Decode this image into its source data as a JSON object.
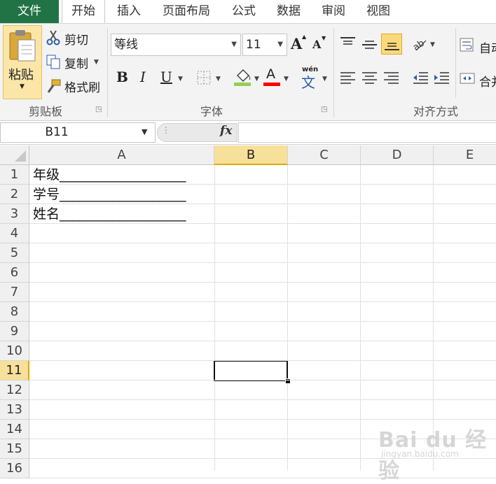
{
  "tabs": {
    "file": "文件",
    "home": "开始",
    "insert": "插入",
    "page_layout": "页面布局",
    "formulas": "公式",
    "data": "数据",
    "review": "审阅",
    "view": "视图"
  },
  "clipboard": {
    "paste": "粘贴",
    "cut": "剪切",
    "copy": "复制",
    "format_painter": "格式刷",
    "group_label": "剪贴板"
  },
  "font": {
    "name": "等线",
    "size": "11",
    "bold": "B",
    "italic": "I",
    "underline": "U",
    "font_color_glyph": "A",
    "grow_glyph": "A",
    "shrink_glyph": "A",
    "phonetic_top": "wén",
    "phonetic_char": "文",
    "group_label": "字体"
  },
  "alignment": {
    "wrap_text": "自动",
    "merge": "合并",
    "group_label": "对齐方式"
  },
  "formula_bar": {
    "name_box": "B11",
    "fx": "fx",
    "formula_value": ""
  },
  "grid": {
    "columns": [
      "A",
      "B",
      "C",
      "D",
      "E"
    ],
    "rows": [
      "1",
      "2",
      "3",
      "4",
      "5",
      "6",
      "7",
      "8",
      "9",
      "10",
      "11",
      "12",
      "13",
      "14",
      "15",
      "16"
    ],
    "selected_column": "B",
    "selected_row": "11",
    "cells": {
      "A1": "年级___________________",
      "A2": "学号___________________",
      "A3": "姓名___________________"
    }
  },
  "watermark": {
    "main": "Bai du 经验",
    "sub": "jingyan.baidu.com"
  },
  "colors": {
    "file_tab": "#217346",
    "selection_header": "#f7e09a",
    "selection_accent": "#e1a800"
  }
}
